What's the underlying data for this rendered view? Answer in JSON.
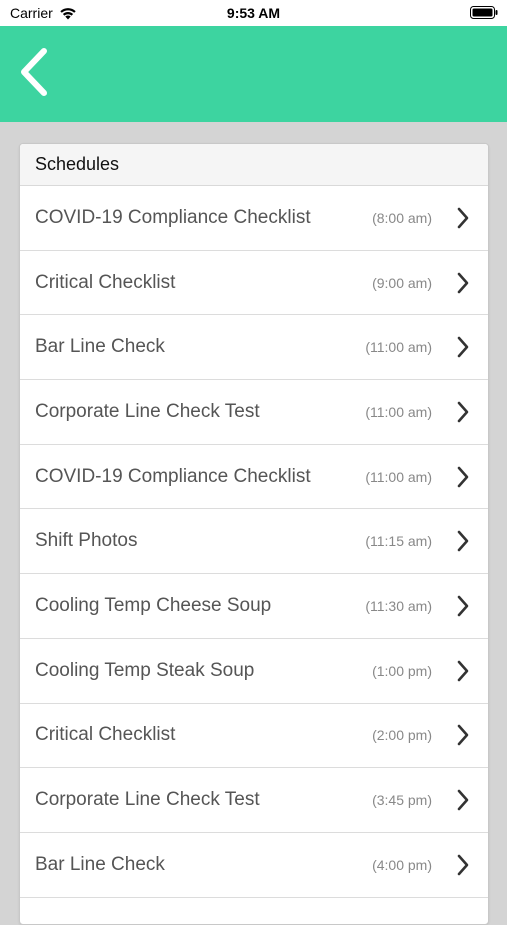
{
  "status_bar": {
    "carrier": "Carrier",
    "time": "9:53 AM"
  },
  "nav": {
    "back_icon": "chevron-left-icon",
    "color": "#3dd4a0"
  },
  "card": {
    "title": "Schedules"
  },
  "schedules": [
    {
      "name": "COVID-19 Compliance Checklist",
      "time": "(8:00 am)"
    },
    {
      "name": "Critical Checklist",
      "time": "(9:00 am)"
    },
    {
      "name": "Bar Line Check",
      "time": "(11:00 am)"
    },
    {
      "name": "Corporate Line Check Test",
      "time": "(11:00 am)"
    },
    {
      "name": "COVID-19 Compliance Checklist",
      "time": "(11:00 am)"
    },
    {
      "name": "Shift Photos",
      "time": "(11:15 am)"
    },
    {
      "name": "Cooling Temp Cheese Soup",
      "time": "(11:30 am)"
    },
    {
      "name": "Cooling Temp Steak Soup",
      "time": "(1:00 pm)"
    },
    {
      "name": "Critical Checklist",
      "time": "(2:00 pm)"
    },
    {
      "name": "Corporate Line Check Test",
      "time": "(3:45 pm)"
    },
    {
      "name": "Bar Line Check",
      "time": "(4:00 pm)"
    }
  ]
}
